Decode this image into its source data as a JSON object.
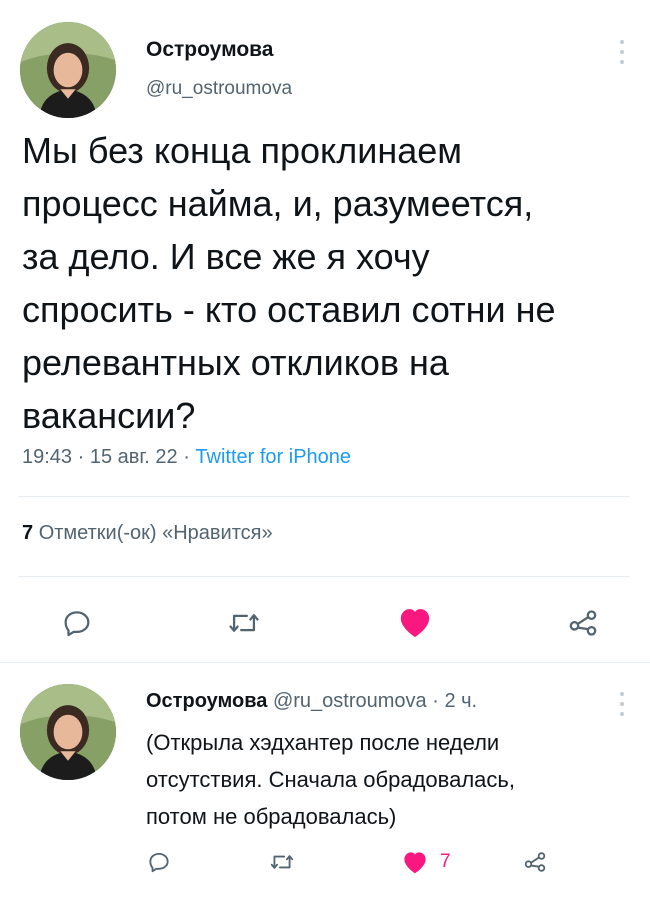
{
  "main_tweet": {
    "author_name": "Остроумова",
    "handle": "@ru_ostroumova",
    "text_lines": [
      "Мы без конца проклинаем",
      "процесс найма, и, разумеется,",
      "за дело. И все же я хочу",
      "спросить - кто оставил сотни не",
      "релевантных откликов на",
      "вакансии?"
    ],
    "time": "19:43",
    "date": "15 авг. 22",
    "separator": "·",
    "source": "Twitter for iPhone",
    "likes_count": "7",
    "likes_label": "Отметки(-ок) «Нравится»"
  },
  "reply": {
    "author_name": "Остроумова",
    "handle": "@ru_ostroumova",
    "age": "· 2 ч.",
    "text_lines": [
      "(Открыла хэдхантер после недели",
      "отсутствия. Сначала обрадовалась,",
      "потом не обрадовалась)"
    ],
    "like_count": "7"
  },
  "colors": {
    "text": "#0f1419",
    "secondary": "#536471",
    "link": "#1d9bf0",
    "like": "#f91880",
    "divider": "#e6ecf0"
  },
  "icons": [
    "more-vertical-icon",
    "reply-icon",
    "retweet-icon",
    "heart-icon",
    "share-icon"
  ]
}
